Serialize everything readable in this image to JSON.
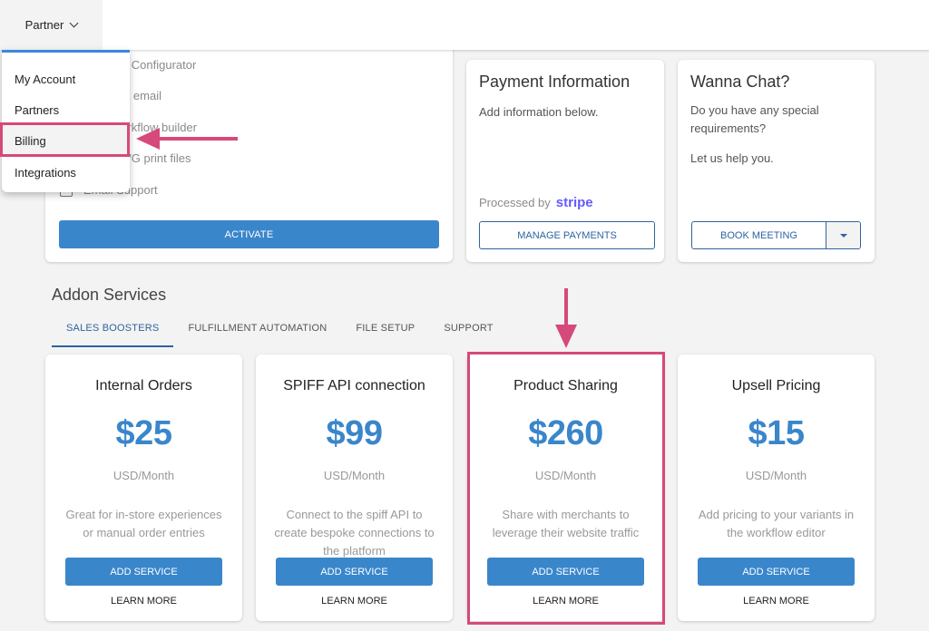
{
  "topbar": {
    "partner_label": "Partner"
  },
  "menu": {
    "items": [
      {
        "label": "My Account"
      },
      {
        "label": "Partners"
      },
      {
        "label": "Billing",
        "highlighted": true
      },
      {
        "label": "Integrations"
      }
    ]
  },
  "plan_card": {
    "features": [
      "Branded Configurator",
      "d PDF to email",
      "Drop workflow builder",
      "/PNG/SVG print files",
      "Email Support"
    ],
    "activate_label": "ACTIVATE"
  },
  "payment_card": {
    "title": "Payment Information",
    "text": "Add information below.",
    "processed_by": "Processed by",
    "processor": "stripe",
    "button_label": "MANAGE PAYMENTS"
  },
  "chat_card": {
    "title": "Wanna Chat?",
    "text1": "Do you have any special requirements?",
    "text2": "Let us help you.",
    "button_label": "BOOK MEETING"
  },
  "addons": {
    "title": "Addon Services",
    "tabs": [
      {
        "label": "SALES BOOSTERS",
        "active": true
      },
      {
        "label": "FULFILLMENT AUTOMATION"
      },
      {
        "label": "FILE SETUP"
      },
      {
        "label": "SUPPORT"
      }
    ],
    "services": [
      {
        "name": "Internal Orders",
        "price": "$25",
        "unit": "USD/Month",
        "desc": "Great for in-store experiences or manual order entries",
        "add_label": "ADD SERVICE",
        "learn_label": "LEARN MORE"
      },
      {
        "name": "SPIFF API connection",
        "price": "$99",
        "unit": "USD/Month",
        "desc": "Connect to the spiff API to create bespoke connections to the platform",
        "add_label": "ADD SERVICE",
        "learn_label": "LEARN MORE"
      },
      {
        "name": "Product Sharing",
        "price": "$260",
        "unit": "USD/Month",
        "desc": "Share with merchants to leverage their website traffic",
        "add_label": "ADD SERVICE",
        "learn_label": "LEARN MORE",
        "highlighted": true
      },
      {
        "name": "Upsell Pricing",
        "price": "$15",
        "unit": "USD/Month",
        "desc": "Add pricing to your variants in the workflow editor",
        "add_label": "ADD SERVICE",
        "learn_label": "LEARN MORE"
      }
    ]
  },
  "colors": {
    "primary": "#3a86cb",
    "outline": "#2f63a0",
    "annotation": "#d6497b",
    "stripe": "#635bff"
  }
}
